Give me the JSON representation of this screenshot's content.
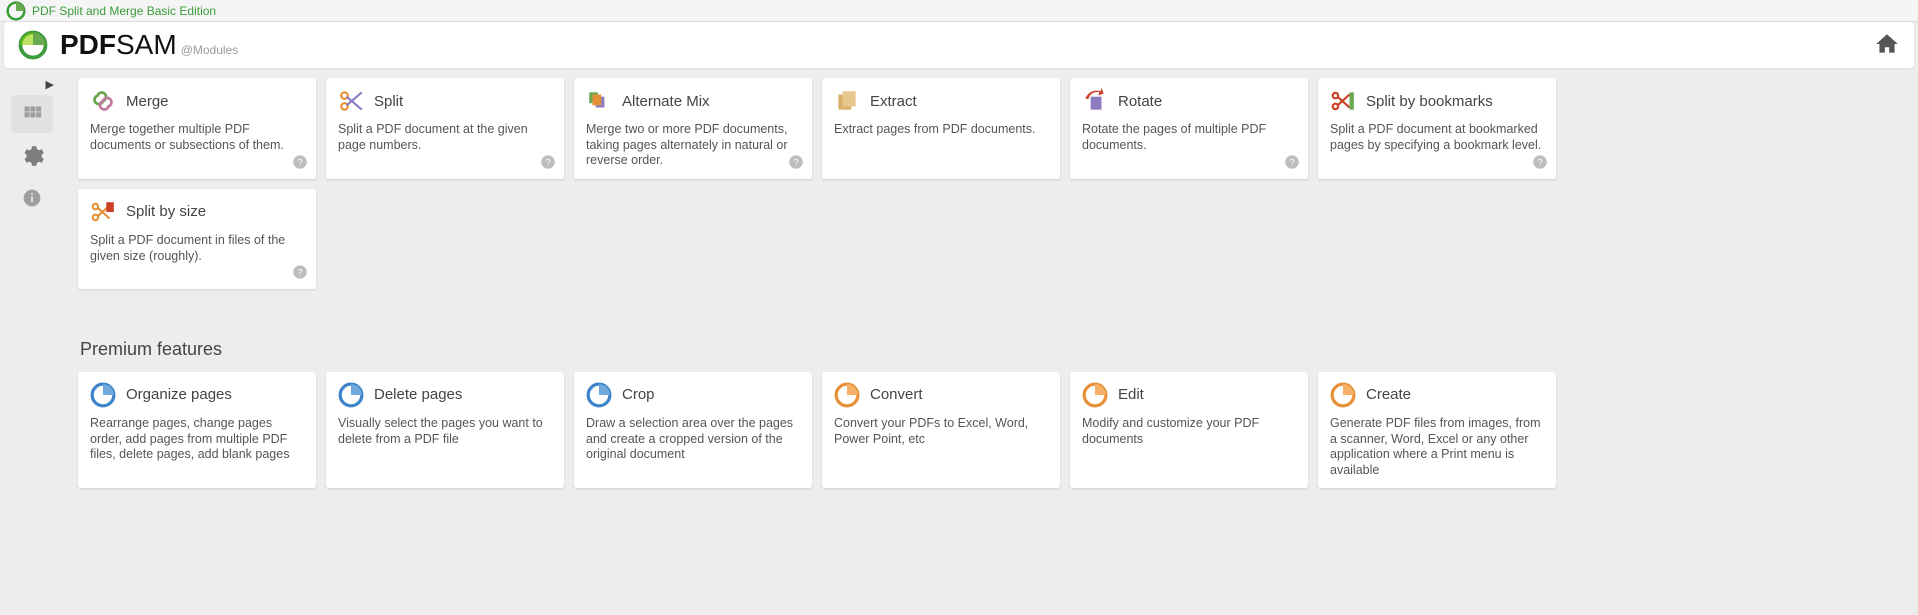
{
  "window_title": "PDF Split and Merge Basic Edition",
  "brand": {
    "a": "PDF",
    "b": "SAM",
    "sub": "@Modules"
  },
  "sidebar": {
    "modules": "Modules",
    "settings": "Settings",
    "info": "About"
  },
  "premium_heading": "Premium features",
  "modules": {
    "merge": {
      "title": "Merge",
      "desc": "Merge together multiple PDF documents or subsections of them."
    },
    "split": {
      "title": "Split",
      "desc": "Split a PDF document at the given page numbers."
    },
    "altmix": {
      "title": "Alternate Mix",
      "desc": "Merge two or more PDF documents, taking pages alternately in natural or reverse order."
    },
    "extract": {
      "title": "Extract",
      "desc": "Extract pages from PDF documents."
    },
    "rotate": {
      "title": "Rotate",
      "desc": "Rotate the pages of multiple PDF documents."
    },
    "splitbm": {
      "title": "Split by bookmarks",
      "desc": "Split a PDF document at bookmarked pages by specifying a bookmark level."
    },
    "splitsz": {
      "title": "Split by size",
      "desc": "Split a PDF document in files of the given size (roughly)."
    }
  },
  "premium": {
    "organize": {
      "title": "Organize pages",
      "desc": "Rearrange pages, change pages order, add pages from multiple PDF files, delete pages, add blank pages"
    },
    "delete": {
      "title": "Delete pages",
      "desc": "Visually select the pages you want to delete from a PDF file"
    },
    "crop": {
      "title": "Crop",
      "desc": "Draw a selection area over the pages and create a cropped version of the original document"
    },
    "convert": {
      "title": "Convert",
      "desc": "Convert your PDFs to Excel, Word, Power Point, etc"
    },
    "edit": {
      "title": "Edit",
      "desc": "Modify and customize your PDF documents"
    },
    "create": {
      "title": "Create",
      "desc": "Generate PDF files from images, from a scanner, Word, Excel or any other application where a Print menu is available"
    }
  }
}
